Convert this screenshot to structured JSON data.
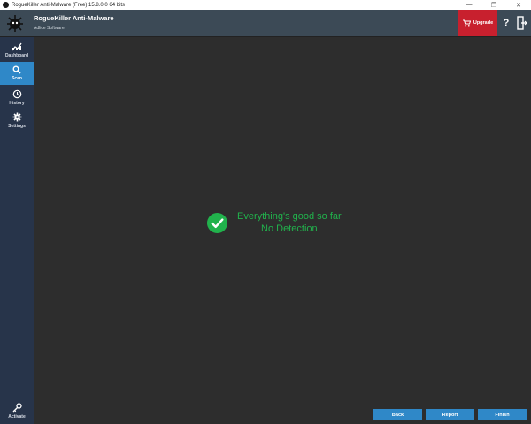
{
  "window": {
    "title": "RogueKiller Anti-Malware (Free) 15.8.0.0 64 bits",
    "minimize_glyph": "—",
    "maximize_glyph": "❐",
    "close_glyph": "✕"
  },
  "header": {
    "app_name": "RogueKiller Anti-Malware",
    "company": "Adlice Software",
    "upgrade_label": "Upgrade",
    "help_glyph": "?"
  },
  "sidebar": {
    "items": [
      {
        "label": "Dashboard",
        "icon": "chart-icon"
      },
      {
        "label": "Scan",
        "icon": "search-icon"
      },
      {
        "label": "History",
        "icon": "history-icon"
      },
      {
        "label": "Settings",
        "icon": "gear-icon"
      }
    ],
    "activate_label": "Activate"
  },
  "main": {
    "status_line1": "Everything's good so far",
    "status_line2": "No Detection"
  },
  "buttons": {
    "back": "Back",
    "report": "Report",
    "finish": "Finish"
  },
  "colors": {
    "accent": "#2f88c8",
    "upgrade": "#c8202e",
    "success": "#21b24c",
    "header": "#3c4a56",
    "sidebar": "#27344a",
    "content": "#2d2d2d"
  }
}
